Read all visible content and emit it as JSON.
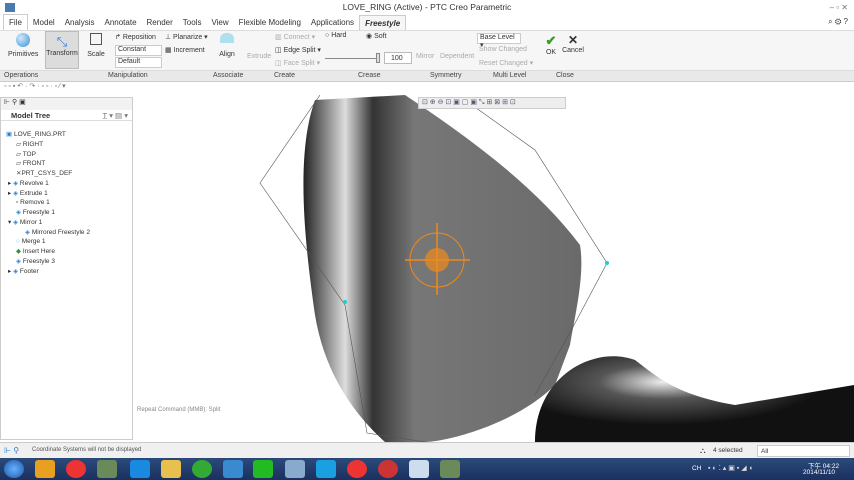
{
  "title": "LOVE_RING (Active) - PTC Creo Parametric",
  "tabs": [
    "File",
    "Model",
    "Analysis",
    "Annotate",
    "Render",
    "Tools",
    "View",
    "Flexible Modeling",
    "Applications",
    "Freestyle"
  ],
  "ribbon": {
    "primitives": "Primitives",
    "transform": "Transform",
    "scale": "Scale",
    "reposition": "Reposition",
    "planarize": "Planarize",
    "constant": "Constant",
    "default": "Default",
    "increment": "Increment",
    "align": "Align",
    "extrude": "Extrude",
    "connect": "Connect",
    "edge_split": "Edge Split",
    "face_split": "Face Split",
    "hard": "Hard",
    "soft": "Soft",
    "crease_value": "100",
    "mirror": "Mirror",
    "dependent": "Dependent",
    "base_level": "Base Level",
    "show_changed": "Show Changed",
    "reset_changed": "Reset Changed",
    "ok": "OK",
    "cancel": "Cancel"
  },
  "groups": [
    "Operations",
    "Manipulation",
    "Associate",
    "Create",
    "Crease",
    "Symmetry",
    "Multi Level",
    "Close"
  ],
  "tree": {
    "title": "Model Tree",
    "items": [
      "LOVE_RING.PRT",
      "RIGHT",
      "TOP",
      "FRONT",
      "PRT_CSYS_DEF",
      "Revolve 1",
      "Extrude 1",
      "Remove 1",
      "Freestyle 1",
      "Mirror 1",
      "Mirrored Freestyle 2",
      "Merge 1",
      "Insert Here",
      "Freestyle 3",
      "Footer"
    ]
  },
  "viewport": {
    "hint": "Repeat Command (MMB): Split"
  },
  "status": {
    "message": "Coordinate Systems will not be displayed",
    "selected": "4 selected",
    "filter": "All"
  },
  "taskbar": {
    "time": "下午 04:22",
    "date": "2014/11/10",
    "lang": "CH"
  },
  "colors": {
    "accent": "#2a7fd4",
    "ok": "#3a9a2a",
    "dragger": "#f08a1a"
  }
}
